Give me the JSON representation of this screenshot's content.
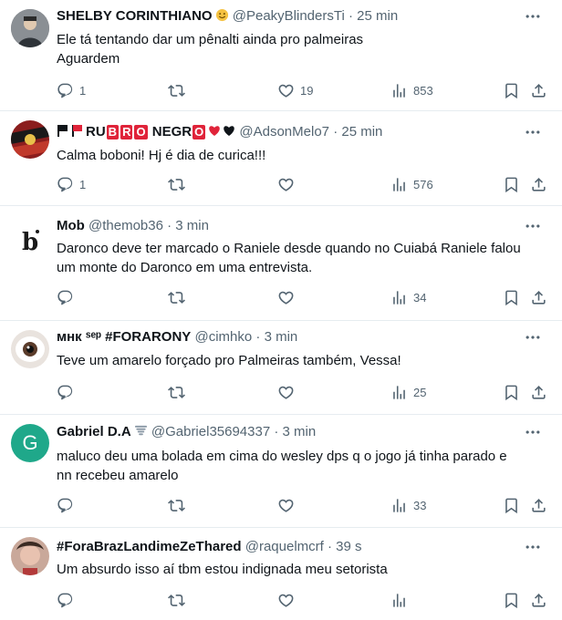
{
  "tweets": [
    {
      "name": "SHELBY CORINTHIANO",
      "handle": "@PeakyBlindersTi",
      "sep": "·",
      "time": "25 min",
      "text": [
        "Ele tá tentando dar um pênalti ainda pro palmeiras",
        "Aguardem"
      ],
      "replies": "1",
      "retweets": "",
      "likes": "19",
      "views": "853",
      "name_badge_icon": "emoji-smile-icon"
    },
    {
      "name_parts": [
        "RU",
        "B",
        "R",
        "O",
        "NEGR",
        "O"
      ],
      "handle": "@AdsonMelo7",
      "sep": "·",
      "time": "25 min",
      "text": [
        "Calma boboni! Hj é dia de curica!!!"
      ],
      "replies": "1",
      "retweets": "",
      "likes": "",
      "views": "576"
    },
    {
      "name": "Mob",
      "handle": "@themob36",
      "sep": "·",
      "time": "3 min",
      "text": [
        "Daronco deve ter marcado o Raniele desde quando no Cuiabá Raniele falou",
        "um monte do Daronco em uma entrevista."
      ],
      "replies": "",
      "retweets": "",
      "likes": "",
      "views": "34"
    },
    {
      "name": "мнк ˢᵉᵖ #FORARONY",
      "handle": "@cimhko",
      "sep": "·",
      "time": "3 min",
      "text": [
        "Teve um amarelo forçado pro Palmeiras também, Vessa!"
      ],
      "replies": "",
      "retweets": "",
      "likes": "",
      "views": "25"
    },
    {
      "name": "Gabriel D.A",
      "handle": "@Gabriel35694337",
      "sep": "·",
      "time": "3 min",
      "avatar_letter": "G",
      "text": [
        "maluco deu uma bolada em cima do wesley dps q o jogo já tinha parado e",
        "nn recebeu amarelo"
      ],
      "replies": "",
      "retweets": "",
      "likes": "",
      "views": "33"
    },
    {
      "name": "#ForaBrazLandimeZeThared",
      "handle": "@raquelmcrf",
      "sep": "·",
      "time": "39 s",
      "text": [
        "Um absurdo isso aí tbm estou indignada meu setorista"
      ],
      "replies": "",
      "retweets": "",
      "likes": "",
      "views": ""
    }
  ],
  "colors": {
    "text": "#0f1419",
    "muted": "#536471",
    "divider": "#e6ecf0",
    "flag_red": "#e0243a",
    "gabriel_avatar": "#1fa88a"
  }
}
